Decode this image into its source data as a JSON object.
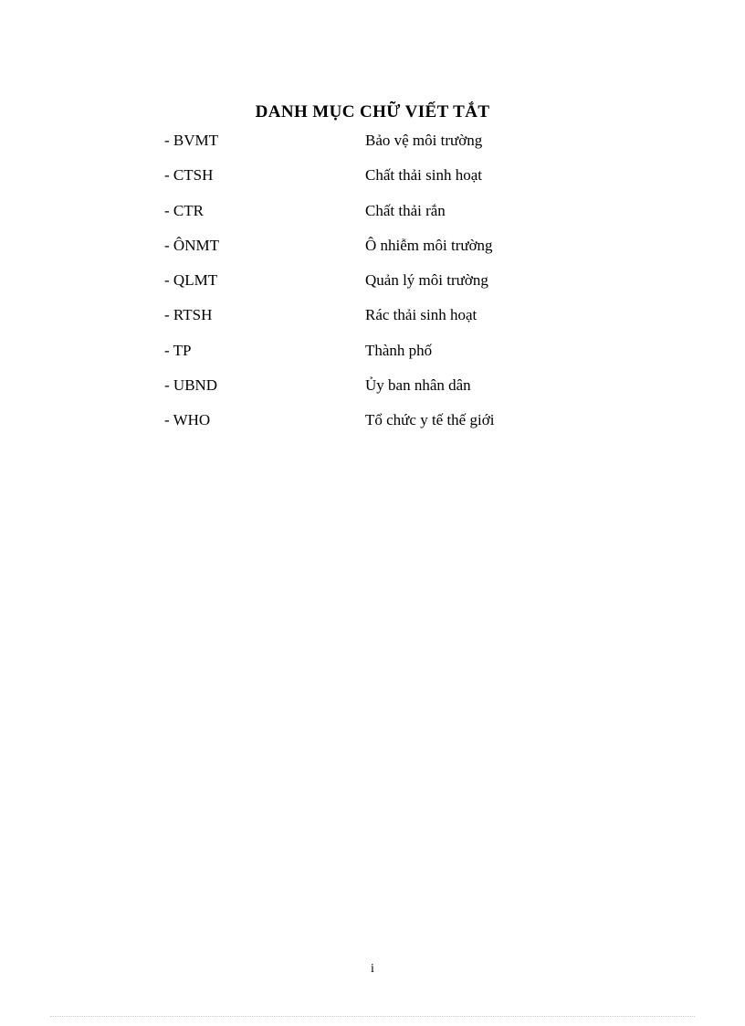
{
  "document": {
    "title": "DANH MỤC CHỮ VIẾT TẮT",
    "page_number": "i",
    "text_color": "#000000",
    "background_color": "#ffffff",
    "footer_rule_color": "#c9c9c9"
  },
  "abbreviations": [
    {
      "term": "- BVMT",
      "definition": "Bảo vệ môi trường"
    },
    {
      "term": "- CTSH",
      "definition": "Chất thải sinh hoạt"
    },
    {
      "term": "- CTR",
      "definition": "Chất thải rắn"
    },
    {
      "term": "- ÔNMT",
      "definition": "Ô nhiễm môi trường"
    },
    {
      "term": "- QLMT",
      "definition": "Quản lý môi trường"
    },
    {
      "term": "- RTSH",
      "definition": "Rác thải sinh hoạt"
    },
    {
      "term": "- TP",
      "definition": "Thành phố"
    },
    {
      "term": "- UBND",
      "definition": "Ủy ban nhân dân"
    },
    {
      "term": "- WHO",
      "definition": "Tổ chức y tế thế giới"
    }
  ]
}
